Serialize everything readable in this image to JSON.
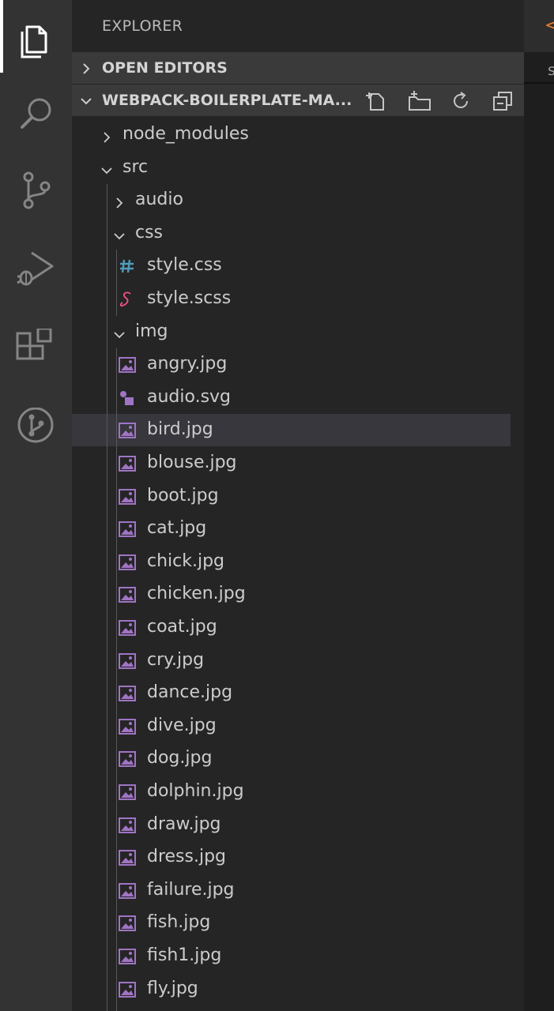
{
  "activity_bar": {
    "items": [
      {
        "name": "files-icon",
        "active": true
      },
      {
        "name": "search-icon",
        "active": false
      },
      {
        "name": "source-control-icon",
        "active": false
      },
      {
        "name": "run-debug-icon",
        "active": false
      },
      {
        "name": "extensions-icon",
        "active": false
      },
      {
        "name": "git-graph-icon",
        "active": false
      }
    ]
  },
  "explorer": {
    "title": "EXPLORER",
    "open_editors_label": "OPEN EDITORS",
    "project_label": "WEBPACK-BOILERPLATE-MA...",
    "project_actions": [
      "new-file-icon",
      "new-folder-icon",
      "refresh-icon",
      "collapse-all-icon"
    ]
  },
  "tree": [
    {
      "label": "node_modules",
      "type": "folder",
      "expanded": false,
      "depth": 0
    },
    {
      "label": "src",
      "type": "folder",
      "expanded": true,
      "depth": 0
    },
    {
      "label": "audio",
      "type": "folder",
      "expanded": false,
      "depth": 1
    },
    {
      "label": "css",
      "type": "folder",
      "expanded": true,
      "depth": 1
    },
    {
      "label": "style.css",
      "type": "css",
      "depth": 2
    },
    {
      "label": "style.scss",
      "type": "scss",
      "depth": 2
    },
    {
      "label": "img",
      "type": "folder",
      "expanded": true,
      "depth": 1
    },
    {
      "label": "angry.jpg",
      "type": "image",
      "depth": 2
    },
    {
      "label": "audio.svg",
      "type": "svg",
      "depth": 2
    },
    {
      "label": "bird.jpg",
      "type": "image",
      "depth": 2,
      "selected": true
    },
    {
      "label": "blouse.jpg",
      "type": "image",
      "depth": 2
    },
    {
      "label": "boot.jpg",
      "type": "image",
      "depth": 2
    },
    {
      "label": "cat.jpg",
      "type": "image",
      "depth": 2
    },
    {
      "label": "chick.jpg",
      "type": "image",
      "depth": 2
    },
    {
      "label": "chicken.jpg",
      "type": "image",
      "depth": 2
    },
    {
      "label": "coat.jpg",
      "type": "image",
      "depth": 2
    },
    {
      "label": "cry.jpg",
      "type": "image",
      "depth": 2
    },
    {
      "label": "dance.jpg",
      "type": "image",
      "depth": 2
    },
    {
      "label": "dive.jpg",
      "type": "image",
      "depth": 2
    },
    {
      "label": "dog.jpg",
      "type": "image",
      "depth": 2
    },
    {
      "label": "dolphin.jpg",
      "type": "image",
      "depth": 2
    },
    {
      "label": "draw.jpg",
      "type": "image",
      "depth": 2
    },
    {
      "label": "dress.jpg",
      "type": "image",
      "depth": 2
    },
    {
      "label": "failure.jpg",
      "type": "image",
      "depth": 2
    },
    {
      "label": "fish.jpg",
      "type": "image",
      "depth": 2
    },
    {
      "label": "fish1.jpg",
      "type": "image",
      "depth": 2
    },
    {
      "label": "fly.jpg",
      "type": "image",
      "depth": 2
    }
  ],
  "editor": {
    "tab_arrow": "<",
    "tab_letter": "s"
  },
  "colors": {
    "css_icon": "#519aba",
    "scss_icon": "#f55385",
    "image_icon": "#a074c4",
    "tab_arrow": "#e37933"
  }
}
